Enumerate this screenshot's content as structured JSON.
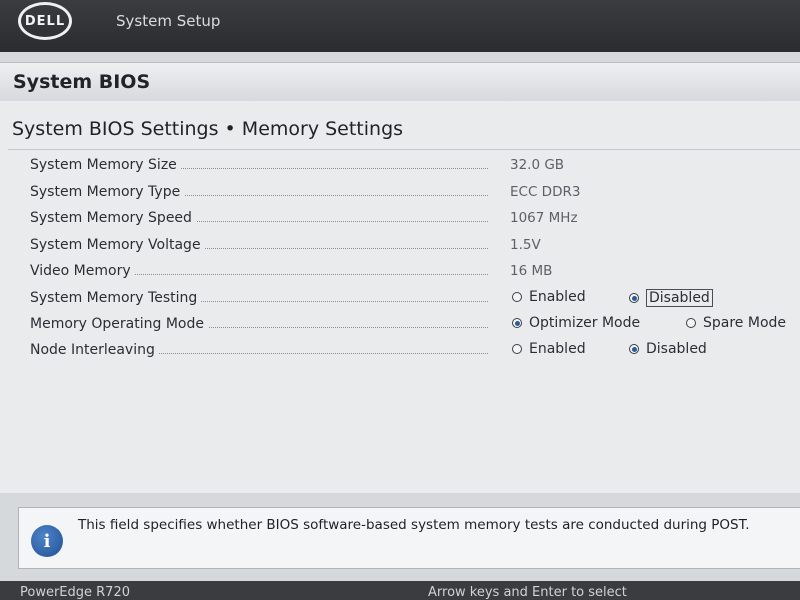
{
  "header": {
    "logo_text": "DELL",
    "title": "System Setup"
  },
  "section": {
    "title": "System BIOS"
  },
  "panel": {
    "title": "System BIOS Settings • Memory Settings",
    "rows": [
      {
        "label": "System Memory Size",
        "value": "32.0 GB"
      },
      {
        "label": "System Memory Type",
        "value": "ECC DDR3"
      },
      {
        "label": "System Memory Speed",
        "value": "1067 MHz"
      },
      {
        "label": "System Memory Voltage",
        "value": "1.5V"
      },
      {
        "label": "Video Memory",
        "value": "16 MB"
      },
      {
        "label": "System Memory Testing",
        "options": [
          "Enabled",
          "Disabled"
        ],
        "selected": "Disabled"
      },
      {
        "label": "Memory Operating Mode",
        "options": [
          "Optimizer Mode",
          "Spare Mode"
        ],
        "selected": "Optimizer Mode"
      },
      {
        "label": "Node Interleaving",
        "options": [
          "Enabled",
          "Disabled"
        ],
        "selected": "Disabled"
      }
    ]
  },
  "help": {
    "icon": "info-icon",
    "text": "This field specifies whether BIOS software-based system memory tests are conducted during POST."
  },
  "footer": {
    "model": "PowerEdge R720",
    "hint": "Arrow keys and Enter to select"
  },
  "colors": {
    "accent": "#2a5b9c",
    "topbar": "#2f3134",
    "panel": "#e9ebed"
  }
}
